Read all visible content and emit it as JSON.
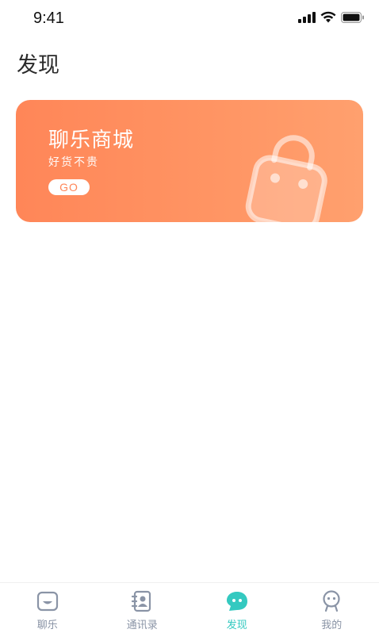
{
  "status_bar": {
    "time": "9:41",
    "icons": [
      "cellular-signal-icon",
      "wifi-icon",
      "battery-icon"
    ]
  },
  "page": {
    "title": "发现"
  },
  "banner": {
    "title": "聊乐商城",
    "subtitle": "好货不贵",
    "button_label": "GO",
    "icon": "shopping-bag-icon",
    "colors": {
      "gradient_start": "#ff8658",
      "gradient_end": "#ffa06e"
    }
  },
  "tab_bar": {
    "active_color": "#34c9c0",
    "inactive_color": "#8a94a6",
    "tabs": [
      {
        "label": "聊乐",
        "icon": "chat-icon",
        "active": false
      },
      {
        "label": "通讯录",
        "icon": "contacts-icon",
        "active": false
      },
      {
        "label": "发现",
        "icon": "discover-icon",
        "active": true
      },
      {
        "label": "我的",
        "icon": "profile-icon",
        "active": false
      }
    ]
  }
}
